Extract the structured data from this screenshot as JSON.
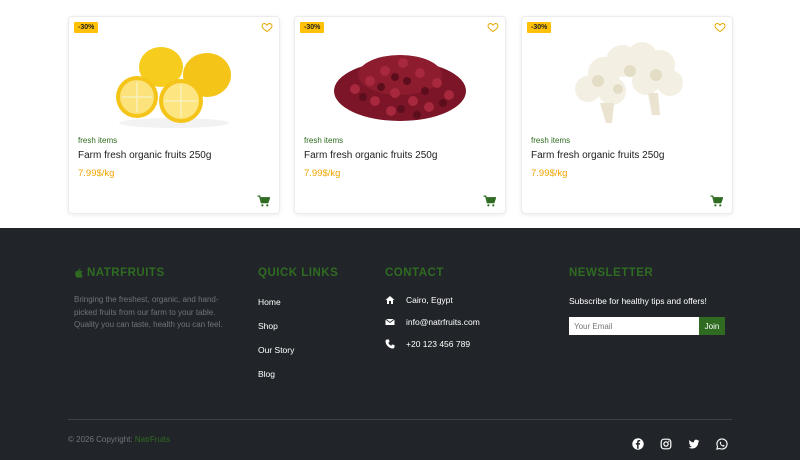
{
  "products": [
    {
      "badge": "-30%",
      "category": "fresh items",
      "name": "Farm fresh organic fruits 250g",
      "price": "7.99$/kg",
      "image": "lemons"
    },
    {
      "badge": "-30%",
      "category": "fresh items",
      "name": "Farm fresh organic fruits 250g",
      "price": "7.99$/kg",
      "image": "dried-cranberries"
    },
    {
      "badge": "-30%",
      "category": "fresh items",
      "name": "Farm fresh organic fruits 250g",
      "price": "7.99$/kg",
      "image": "cauliflower"
    }
  ],
  "footer": {
    "brand": "NATRFRUITS",
    "about": "Bringing the freshest, organic, and hand-picked fruits from our farm to your table. Quality you can taste, health you can feel.",
    "quick_links_title": "QUICK LINKS",
    "quick_links": [
      "Home",
      "Shop",
      "Our Story",
      "Blog"
    ],
    "contact_title": "CONTACT",
    "contact": [
      {
        "icon": "home-icon",
        "text": "Cairo, Egypt"
      },
      {
        "icon": "mail-icon",
        "text": "info@natrfruits.com"
      },
      {
        "icon": "phone-icon",
        "text": "+20 123 456 789"
      }
    ],
    "newsletter_title": "NEWSLETTER",
    "newsletter_text": "Subscribe for healthy tips and offers!",
    "email_placeholder": "Your Email",
    "join_label": "Join",
    "copyright": "© 2026 Copyright:",
    "copyright_brand": "NatrFruits",
    "social": [
      "facebook-icon",
      "instagram-icon",
      "twitter-icon",
      "whatsapp-icon"
    ]
  },
  "colors": {
    "accent": "#2f6b21",
    "price": "#f0a500",
    "badge": "#ffc107",
    "footer_bg": "#212529"
  }
}
